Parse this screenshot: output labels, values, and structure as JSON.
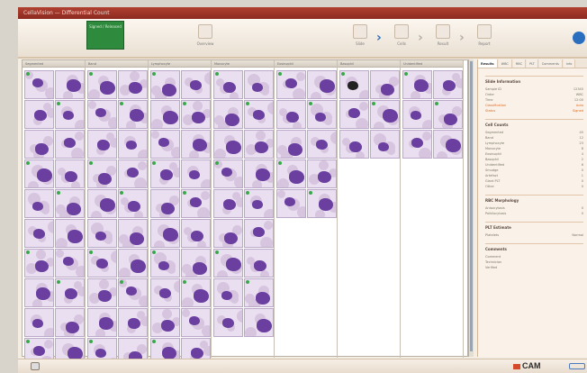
{
  "window": {
    "title": "CellaVision — Differential Count"
  },
  "toolbar": {
    "green_button_text": "Signed / Released",
    "btn1": "Overview",
    "btn2": "Slide",
    "btn3": "Cells",
    "btn4": "Result",
    "btn5": "Report",
    "btn6": "Sign"
  },
  "columns": [
    {
      "name": "Segmented",
      "count": 10
    },
    {
      "name": "Band",
      "count": 10
    },
    {
      "name": "Lymphocyte",
      "count": 10
    },
    {
      "name": "Monocyte",
      "count": 9
    },
    {
      "name": "Eosinophil",
      "count": 5
    },
    {
      "name": "Basophil",
      "count": 3
    },
    {
      "name": "Unidentified",
      "count": 3
    }
  ],
  "right_panel": {
    "tabs": [
      "Results",
      "WBC",
      "RBC",
      "PLT",
      "Comments",
      "Info"
    ],
    "active_tab": 0,
    "sections": [
      {
        "title": "Slide Information",
        "rows": [
          [
            "Sample ID",
            "12345"
          ],
          [
            "Order",
            "WBC"
          ],
          [
            "Time",
            "12:00"
          ],
          [
            "Classification",
            "Auto"
          ],
          [
            "Status",
            "Signed"
          ]
        ]
      },
      {
        "title": "Cell Counts",
        "rows": [
          [
            "Segmented",
            "45"
          ],
          [
            "Band",
            "12"
          ],
          [
            "Lymphocyte",
            "23"
          ],
          [
            "Monocyte",
            "8"
          ],
          [
            "Eosinophil",
            "4"
          ],
          [
            "Basophil",
            "2"
          ],
          [
            "Unidentified",
            "6"
          ],
          [
            "Smudge",
            "0"
          ],
          [
            "Artefact",
            "1"
          ],
          [
            "Giant PLT",
            "0"
          ],
          [
            "Other",
            "0"
          ]
        ]
      },
      {
        "title": "RBC Morphology",
        "rows": [
          [
            "Anisocytosis",
            "0"
          ],
          [
            "Poikilocytosis",
            "0"
          ]
        ]
      },
      {
        "title": "PLT Estimate",
        "rows": [
          [
            "Platelets",
            "Normal"
          ]
        ]
      },
      {
        "title": "Comments",
        "rows": [
          [
            "Comment",
            ""
          ],
          [
            "Technician",
            ""
          ],
          [
            "Verified",
            ""
          ]
        ]
      }
    ]
  },
  "status": {
    "logo_text": "CAM"
  }
}
